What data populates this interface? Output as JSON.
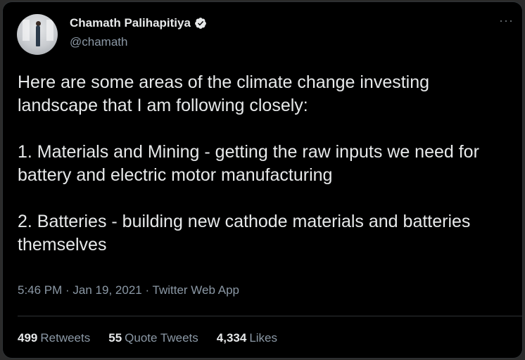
{
  "author": {
    "display_name": "Chamath Palihapitiya",
    "handle": "@chamath",
    "verified": true,
    "avatar_icon": "profile-photo"
  },
  "menu": {
    "more_label": "···"
  },
  "tweet": {
    "paragraphs": [
      "Here are some areas of the climate change investing landscape that I am following closely:",
      "1. Materials and Mining - getting the raw inputs we need for battery and electric motor manufacturing",
      "2. Batteries - building new cathode materials and batteries themselves"
    ]
  },
  "meta": {
    "time_date_source": "5:46 PM · Jan 19, 2021 · Twitter Web App"
  },
  "stats": {
    "retweets": {
      "count": "499",
      "label": "Retweets"
    },
    "quote_tweets": {
      "count": "55",
      "label": "Quote Tweets"
    },
    "likes": {
      "count": "4,334",
      "label": "Likes"
    }
  },
  "colors": {
    "background": "#000000",
    "text_primary": "#e7e9ea",
    "text_secondary": "#8b98a5",
    "border": "#2f3336"
  }
}
